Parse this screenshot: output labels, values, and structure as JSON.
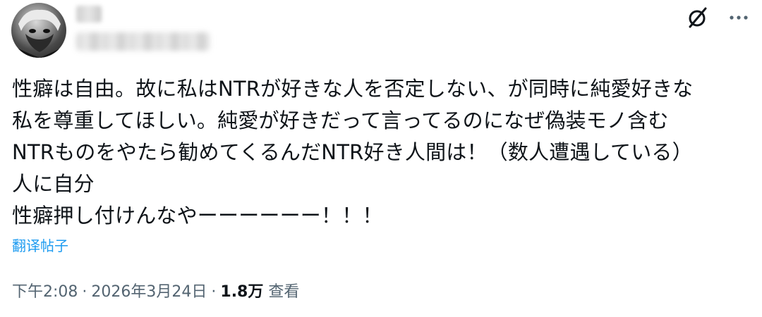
{
  "author": {
    "avatar_icon": "user-avatar-icon"
  },
  "actions": {
    "grok_icon": "grok-slash-icon",
    "more_icon": "more-dots-icon"
  },
  "post": {
    "lines": [
      "性癖は自由。故に私はNTRが好きな人を否定しない、が同時に純愛好きな",
      "私を尊重してほしい。純愛が好きだって言ってるのになぜ偽装モノ含む",
      "NTRものをやたら勧めてくるんだNTR好き人間は！（数人遭遇している）",
      "人に自分",
      "性癖押し付けんなやーーーーーー！！！"
    ],
    "translate_label": "翻译帖子"
  },
  "meta": {
    "time": "下午2:08",
    "separator": "·",
    "date": "2026年3月24日",
    "views_count": "1.8万",
    "views_label": "查看"
  },
  "colors": {
    "text": "#0f1419",
    "secondary": "#536471",
    "link": "#1d9bf0"
  }
}
